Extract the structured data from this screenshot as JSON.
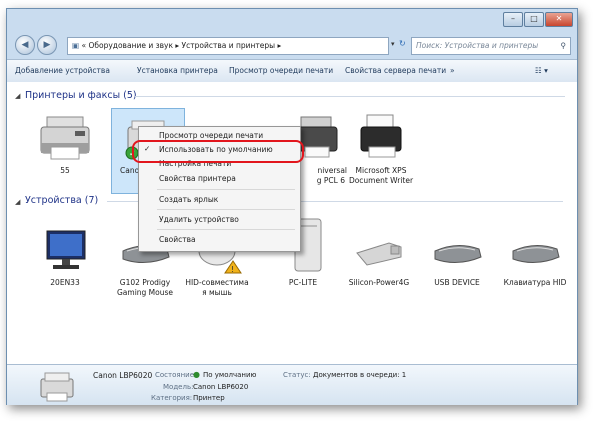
{
  "address": {
    "back_icon": "back-arrow-icon",
    "forward_icon": "forward-arrow-icon",
    "breadcrumb": [
      "Оборудование и звук",
      "Устройства и принтеры"
    ],
    "search_placeholder": "Поиск: Устройства и принтеры"
  },
  "toolbar": {
    "items": [
      "Добавление устройства",
      "Установка принтера",
      "Просмотр очереди печати",
      "Свойства сервера печати"
    ],
    "more": "»"
  },
  "groups": {
    "printers": {
      "title": "Принтеры и факсы (5)"
    },
    "devices": {
      "title": "Устройства (7)"
    }
  },
  "printers": [
    {
      "label": "55"
    },
    {
      "label": "Cano"
    },
    {
      "label": "niversal",
      "label2": "g PCL 6"
    },
    {
      "label": "Microsoft XPS",
      "label2": "Document Writer"
    }
  ],
  "devices": [
    {
      "label": "20EN33"
    },
    {
      "label": "G102 Prodigy",
      "label2": "Gaming Mouse"
    },
    {
      "label": "HID-совместима",
      "label2": "я мышь"
    },
    {
      "label": "PC-LITE"
    },
    {
      "label": "Silicon-Power4G"
    },
    {
      "label": "USB DEVICE"
    },
    {
      "label": "Клавиатура HID"
    }
  ],
  "context_menu": {
    "items": [
      "Просмотр очереди печати",
      "Использовать по умолчанию",
      "Настройка печати",
      "Свойства принтера",
      "Создать ярлык",
      "Удалить устройство",
      "Свойства"
    ],
    "check_mark": "✓"
  },
  "details": {
    "name": "Canon LBP6020",
    "state_key": "Состояние:",
    "state_val": "По умолчанию",
    "model_key": "Модель:",
    "model_val": "Canon LBP6020",
    "category_key": "Категория:",
    "category_val": "Принтер",
    "status_key": "Статус:",
    "status_val": "Документов в очереди: 1"
  },
  "colors": {
    "accent": "#1e3287",
    "highlight_border": "#e2161d",
    "selection": "#cde6fa"
  }
}
